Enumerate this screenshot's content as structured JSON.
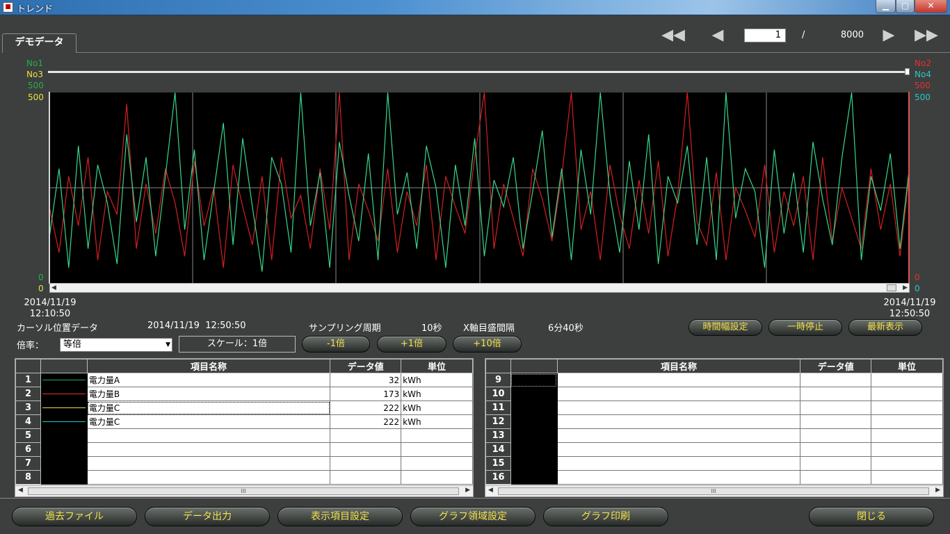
{
  "window": {
    "title": "トレンド",
    "icon_label": "■",
    "min": "▁",
    "max": "▢",
    "close": "✕"
  },
  "tab": {
    "label": "デモデータ"
  },
  "pager": {
    "first": "◀◀",
    "prev": "◀",
    "next": "▶",
    "last": "▶▶",
    "current": "1",
    "separator": "/",
    "total": "8000"
  },
  "axes": {
    "left": {
      "no1": "No1",
      "no3": "No3",
      "max1": "500",
      "max3": "500",
      "min1": "0",
      "min3": "0"
    },
    "right": {
      "no2": "No2",
      "no4": "No4",
      "max2": "500",
      "max4": "500",
      "min2": "0",
      "min4": "0"
    },
    "start_date": "2014/11/19",
    "start_time": "12:10:50",
    "end_date": "2014/11/19",
    "end_time": "12:50:50"
  },
  "colors": {
    "no1": "#22b04a",
    "no2": "#e53030",
    "no3": "#e8e040",
    "no4": "#2ec6c6",
    "trace_green": "#38d88a",
    "trace_red": "#d42020"
  },
  "info": {
    "cursor_label": "カーソル位置データ",
    "cursor_value": "2014/11/19  12:50:50",
    "sampling_label": "サンプリング周期",
    "sampling_value": "10秒",
    "xaxis_label": "X軸目盛間隔",
    "xaxis_value": "6分40秒"
  },
  "controls": {
    "time_width": "時間幅設定",
    "pause": "一時停止",
    "latest": "最新表示",
    "rate_label": "倍率：",
    "rate_value": "等倍",
    "scale": "スケール：1倍",
    "minus1": "-1倍",
    "plus1": "+1倍",
    "plus10": "+10倍"
  },
  "table": {
    "headers": {
      "name": "項目名称",
      "value": "データ値",
      "unit": "単位"
    },
    "left_rows": [
      {
        "no": "1",
        "name": "電力量A",
        "value": "32",
        "unit": "kWh"
      },
      {
        "no": "2",
        "name": "電力量B",
        "value": "173",
        "unit": "kWh"
      },
      {
        "no": "3",
        "name": "電力量C",
        "value": "222",
        "unit": "kWh"
      },
      {
        "no": "4",
        "name": "電力量C",
        "value": "222",
        "unit": "kWh"
      },
      {
        "no": "5",
        "name": "",
        "value": "",
        "unit": ""
      },
      {
        "no": "6",
        "name": "",
        "value": "",
        "unit": ""
      },
      {
        "no": "7",
        "name": "",
        "value": "",
        "unit": ""
      },
      {
        "no": "8",
        "name": "",
        "value": "",
        "unit": ""
      }
    ],
    "right_rows": [
      {
        "no": "9"
      },
      {
        "no": "10"
      },
      {
        "no": "11"
      },
      {
        "no": "12"
      },
      {
        "no": "13"
      },
      {
        "no": "14"
      },
      {
        "no": "15"
      },
      {
        "no": "16"
      }
    ],
    "scroll_left": "◀",
    "scroll_right": "▶",
    "scroll_grip": "III"
  },
  "bottom": {
    "past_file": "過去ファイル",
    "data_output": "データ出力",
    "display_items": "表示項目設定",
    "graph_area": "グラフ領域設定",
    "graph_print": "グラフ印刷",
    "close": "閉じる"
  },
  "chart_data": {
    "type": "line",
    "ylim": [
      0,
      500
    ],
    "x_start": "2014/11/19 12:10:50",
    "x_end": "2014/11/19 12:50:50",
    "series": [
      {
        "name": "No1",
        "color": "#38d88a",
        "values": [
          120,
          300,
          40,
          360,
          90,
          310,
          210,
          50,
          390,
          160,
          330,
          70,
          280,
          500,
          140,
          350,
          60,
          240,
          420,
          100,
          380,
          200,
          30,
          330,
          260,
          80,
          500,
          150,
          290,
          40,
          370,
          230,
          110,
          340,
          60,
          500,
          180,
          290,
          90,
          360,
          250,
          40,
          310,
          150,
          380,
          70,
          270,
          200,
          330,
          90,
          240,
          400,
          120,
          300,
          60,
          350,
          180,
          500,
          230,
          80,
          320,
          140,
          390,
          50,
          280,
          210,
          360,
          100,
          330,
          60,
          500,
          170,
          300,
          240,
          40,
          350,
          130,
          290,
          80,
          370,
          220,
          100,
          330,
          500,
          60,
          280,
          190,
          340,
          90,
          310
        ]
      },
      {
        "name": "No2",
        "color": "#d42020",
        "values": [
          200,
          80,
          280,
          150,
          330,
          60,
          240,
          180,
          470,
          90,
          260,
          130,
          300,
          210,
          70,
          320,
          150,
          250,
          40,
          310,
          200,
          100,
          280,
          60,
          330,
          170,
          230,
          90,
          300,
          140,
          500,
          60,
          260,
          190,
          110,
          300,
          80,
          240,
          150,
          310,
          60,
          280,
          200,
          130,
          330,
          500,
          90,
          260,
          170,
          70,
          300,
          220,
          110,
          280,
          500,
          140,
          240,
          60,
          310,
          180,
          90,
          270,
          130,
          320,
          70,
          230,
          500,
          160,
          100,
          290,
          60,
          250,
          190,
          120,
          310,
          80,
          240,
          150,
          280,
          60,
          330,
          110,
          250,
          170,
          90,
          300,
          140,
          260,
          70,
          290
        ]
      }
    ]
  }
}
